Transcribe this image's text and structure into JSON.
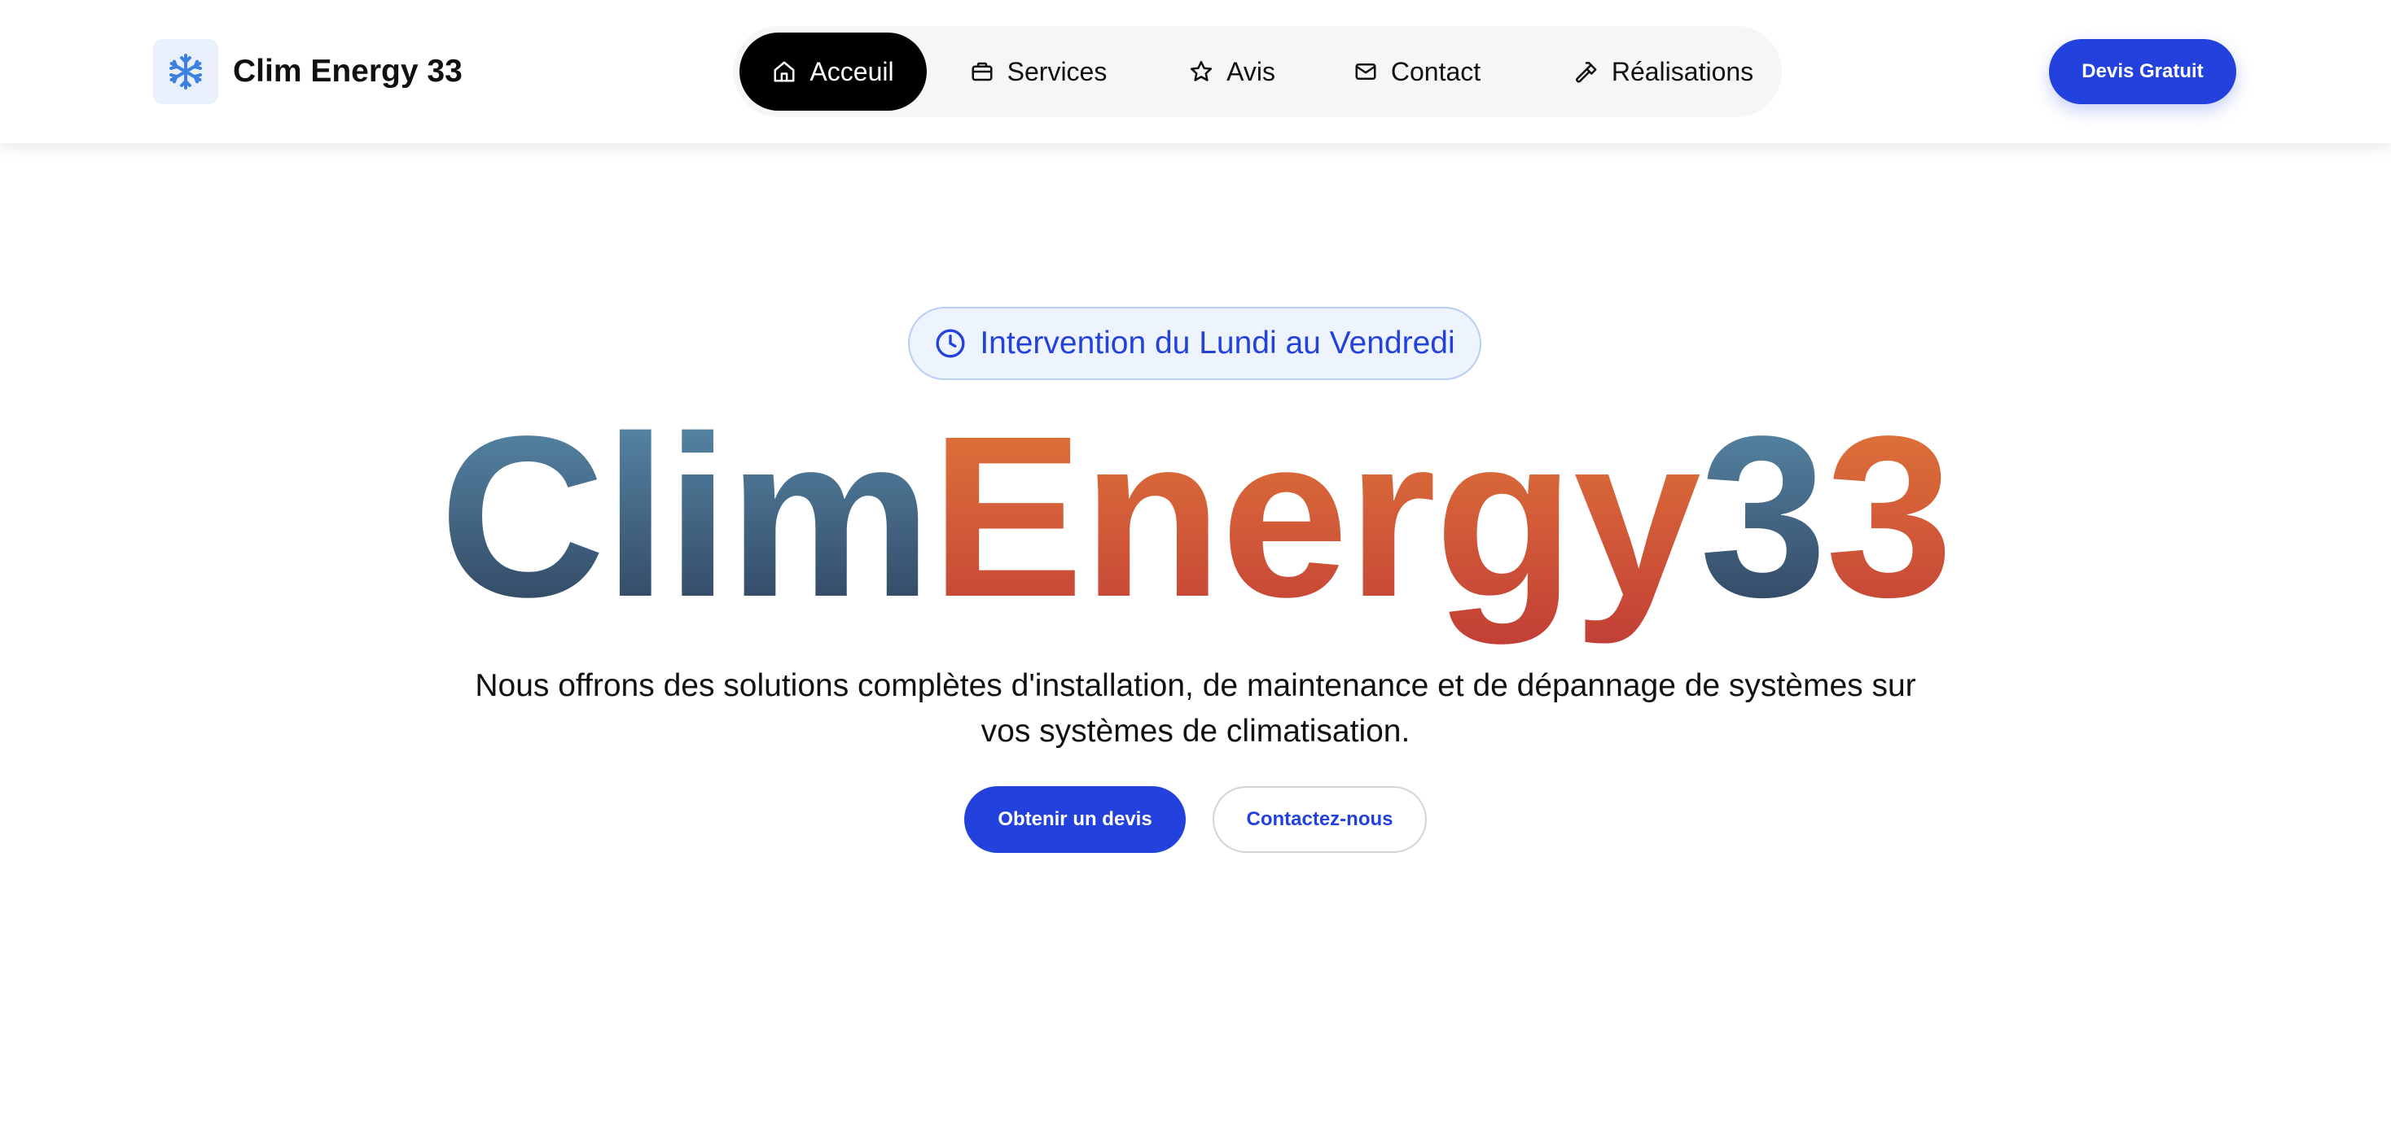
{
  "brand": {
    "name": "Clim Energy 33",
    "icon": "snowflake-icon",
    "icon_color": "#3b82e0"
  },
  "nav": {
    "items": [
      {
        "label": "Acceuil",
        "icon": "home-icon",
        "active": true
      },
      {
        "label": "Services",
        "icon": "briefcase-icon",
        "active": false
      },
      {
        "label": "Avis",
        "icon": "star-icon",
        "active": false
      },
      {
        "label": "Contact",
        "icon": "mail-icon",
        "active": false
      },
      {
        "label": "Réalisations",
        "icon": "hammer-icon",
        "active": false
      }
    ]
  },
  "header_cta": {
    "label": "Devis Gratuit"
  },
  "hero": {
    "badge": {
      "text": "Intervention du Lundi au Vendredi",
      "icon": "clock-icon"
    },
    "title": {
      "part1": "Clim",
      "part2": "Energy",
      "part3": "3",
      "part4": "3"
    },
    "description": "Nous offrons des solutions complètes d'installation, de maintenance et de dépannage de systèmes sur vos systèmes de climatisation.",
    "primary_button": "Obtenir un devis",
    "secondary_button": "Contactez-nous"
  },
  "colors": {
    "accent_blue": "#2342dd",
    "title_blue_top": "#5b8fae",
    "title_blue_bottom": "#2c3e5a",
    "title_orange_top": "#e37a3a",
    "title_orange_bottom": "#c23f36"
  }
}
